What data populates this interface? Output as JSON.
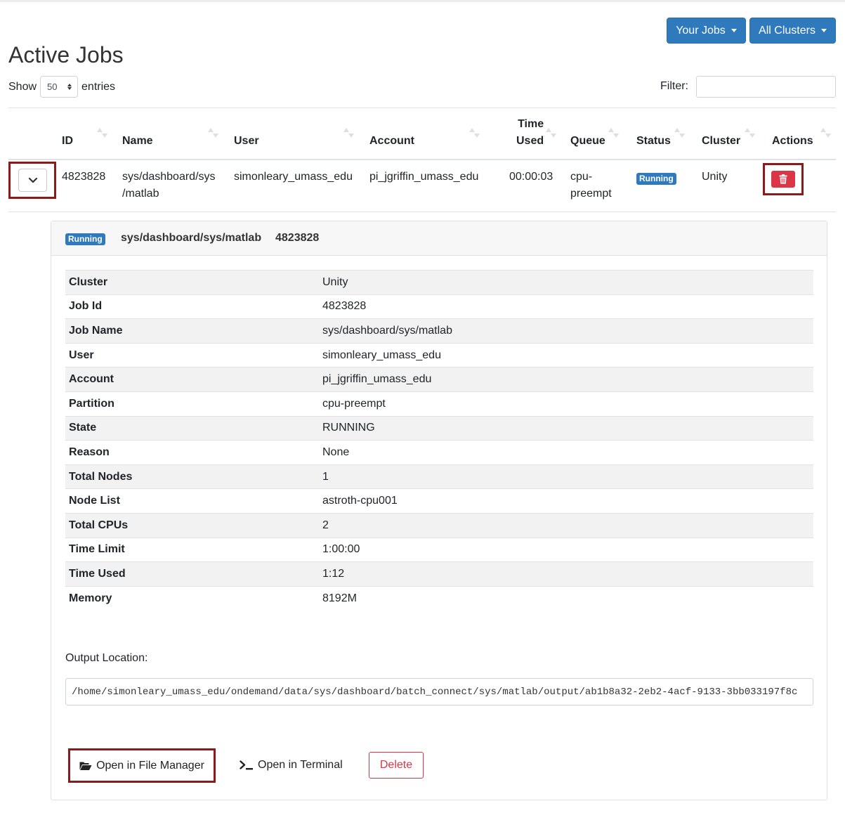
{
  "header": {
    "your_jobs_label": "Your Jobs",
    "all_clusters_label": "All Clusters",
    "title": "Active Jobs"
  },
  "controls": {
    "show_label": "Show",
    "entries_value": "50",
    "entries_label": "entries",
    "filter_label": "Filter:",
    "filter_value": ""
  },
  "table": {
    "columns": [
      "ID",
      "Name",
      "User",
      "Account",
      "Time Used",
      "Queue",
      "Status",
      "Cluster",
      "Actions"
    ],
    "time_used_col": [
      "Time",
      "Used"
    ],
    "row": {
      "id": "4823828",
      "name_line1": "sys/dashboard/sys",
      "name_line2": "/matlab",
      "user": "simonleary_umass_edu",
      "account": "pi_jgriffin_umass_edu",
      "time_used": "00:00:03",
      "queue_line1": "cpu-",
      "queue_line2": "preempt",
      "status": "Running",
      "cluster": "Unity"
    }
  },
  "details": {
    "status": "Running",
    "title": "sys/dashboard/sys/matlab",
    "job_id": "4823828",
    "rows": [
      {
        "key": "Cluster",
        "value": "Unity"
      },
      {
        "key": "Job Id",
        "value": "4823828"
      },
      {
        "key": "Job Name",
        "value": "sys/dashboard/sys/matlab"
      },
      {
        "key": "User",
        "value": "simonleary_umass_edu"
      },
      {
        "key": "Account",
        "value": "pi_jgriffin_umass_edu"
      },
      {
        "key": "Partition",
        "value": "cpu-preempt"
      },
      {
        "key": "State",
        "value": "RUNNING"
      },
      {
        "key": "Reason",
        "value": "None"
      },
      {
        "key": "Total Nodes",
        "value": "1"
      },
      {
        "key": "Node List",
        "value": "astroth-cpu001"
      },
      {
        "key": "Total CPUs",
        "value": "2"
      },
      {
        "key": "Time Limit",
        "value": "1:00:00"
      },
      {
        "key": "Time Used",
        "value": "1:12"
      },
      {
        "key": "Memory",
        "value": "8192M"
      }
    ],
    "output_label": "Output Location:",
    "output_path": "/home/simonleary_umass_edu/ondemand/data/sys/dashboard/batch_connect/sys/matlab/output/ab1b8a32-2eb2-4acf-9133-3bb033197f8c",
    "open_file_manager_label": "Open in File Manager",
    "open_terminal_label": "Open in Terminal",
    "delete_label": "Delete"
  },
  "colors": {
    "primary": "#2e7abd",
    "danger": "#dc3545",
    "highlight_border": "#8b1a1a"
  }
}
